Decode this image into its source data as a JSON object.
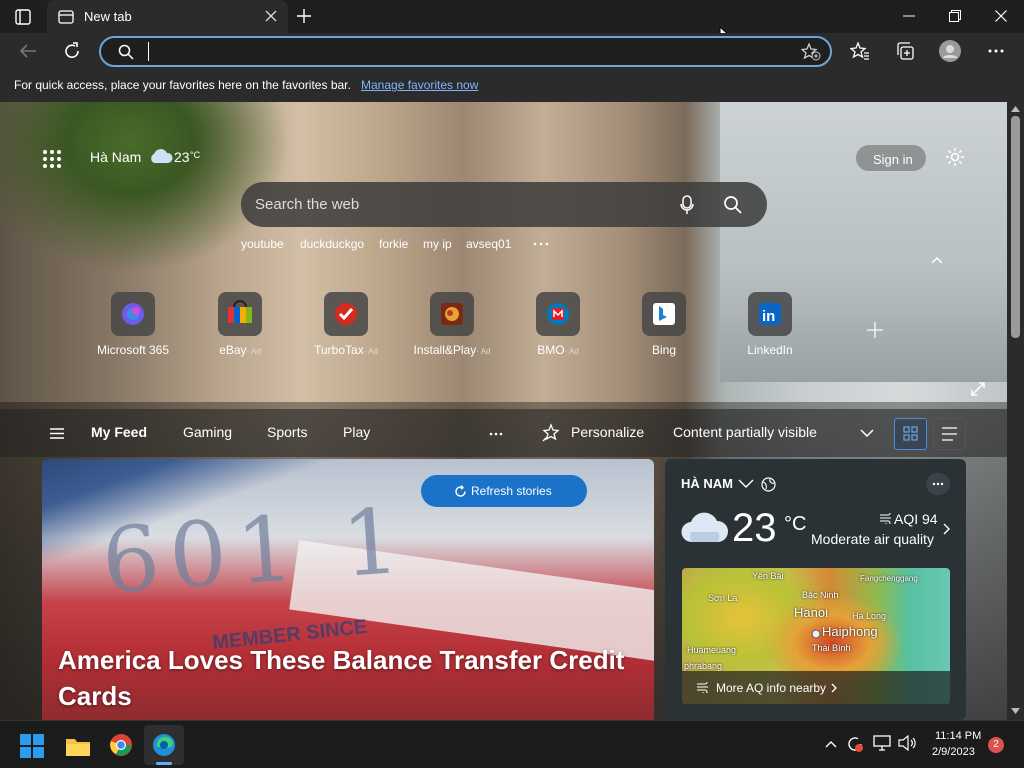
{
  "browser": {
    "tab_title": "New tab",
    "address_value": "",
    "favorites_bar": {
      "message": "For quick access, place your favorites here on the favorites bar.",
      "link": "Manage favorites now"
    }
  },
  "newtab": {
    "location": "Hà Nam",
    "temp": "23",
    "temp_unit": "°C",
    "signin": "Sign in",
    "search_placeholder": "Search the web",
    "chips": [
      "youtube",
      "duckduckgo",
      "forkie",
      "my ip",
      "avseq01"
    ],
    "tiles": [
      {
        "label": "Microsoft 365",
        "ad": ""
      },
      {
        "label": "eBay",
        "ad": "· Ad"
      },
      {
        "label": "TurboTax",
        "ad": "· Ad"
      },
      {
        "label": "Install&Play",
        "ad": "· Ad"
      },
      {
        "label": "BMO",
        "ad": "· Ad"
      },
      {
        "label": "Bing",
        "ad": ""
      },
      {
        "label": "LinkedIn",
        "ad": ""
      }
    ],
    "feed": {
      "tabs": [
        "My Feed",
        "Gaming",
        "Sports",
        "Play"
      ],
      "personalize": "Personalize",
      "visibility": "Content partially visible",
      "refresh": "Refresh stories",
      "headline": "America Loves These Balance Transfer Credit Cards",
      "card_image_text": "601 1",
      "card_image_subtext": "MEMBER SINCE"
    },
    "weather": {
      "location": "HÀ NAM",
      "temp": "23",
      "unit": "°C",
      "aqi": "AQI 94",
      "aqi_desc": "Moderate air quality",
      "more": "More AQ info nearby",
      "map_labels": [
        "Yên Bái",
        "Fangchenggang",
        "Bắc Ninh",
        "Sơn La",
        "Hanoi",
        "Ha Long",
        "Haiphong",
        "Huameuang",
        "Thái Bình",
        "phrabang"
      ]
    }
  },
  "taskbar": {
    "time": "11:14 PM",
    "date": "2/9/2023",
    "notifications": "2"
  },
  "colors": {
    "accent": "#1a73c8",
    "link": "#7fb4ff",
    "address_border": "#6aa6d8"
  }
}
